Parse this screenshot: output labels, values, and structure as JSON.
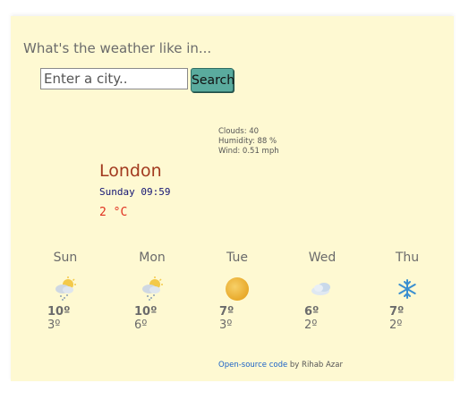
{
  "search": {
    "prompt": "What's the weather like in...",
    "placeholder": "Enter a city..",
    "button_label": "Search"
  },
  "current": {
    "clouds": "Clouds: 40",
    "humidity": "Humidity: 88 %",
    "wind": "Wind: 0.51 mph",
    "city": "London",
    "datetime": "Sunday 09:59",
    "temperature": "2 °C"
  },
  "forecast": [
    {
      "day": "Sun",
      "icon": "snow-cloud-sun-icon",
      "high": "10º",
      "low": "3º"
    },
    {
      "day": "Mon",
      "icon": "snow-cloud-sun-icon",
      "high": "10º",
      "low": "6º"
    },
    {
      "day": "Tue",
      "icon": "sun-icon",
      "high": "7º",
      "low": "3º"
    },
    {
      "day": "Wed",
      "icon": "cloud-icon",
      "high": "6º",
      "low": "2º"
    },
    {
      "day": "Thu",
      "icon": "snowflake-icon",
      "high": "7º",
      "low": "2º"
    }
  ],
  "footer": {
    "link_text": "Open-source code",
    "by_text": " by Rihab Azar"
  },
  "colors": {
    "background": "#fef9d2",
    "button": "#5aab9e",
    "city": "#a23a1f",
    "datetime": "#141474",
    "temperature": "#e0301e",
    "link": "#1a62c7"
  }
}
